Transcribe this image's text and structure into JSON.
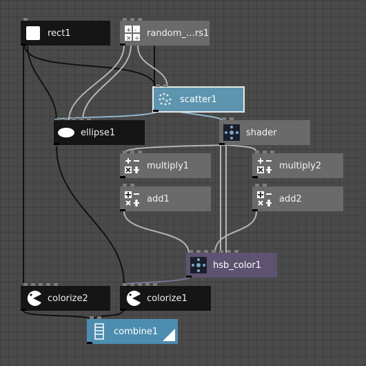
{
  "nodes": {
    "rect1": {
      "label": "rect1",
      "icon": "white-square-icon"
    },
    "random": {
      "label": "random_…rs1",
      "icon": "math-grid-icon"
    },
    "scatter1": {
      "label": "scatter1",
      "icon": "scatter-dots-icon"
    },
    "ellipse1": {
      "label": "ellipse1",
      "icon": "ellipse-icon"
    },
    "shader": {
      "label": "shader",
      "icon": "shader-crosshair-icon"
    },
    "multiply1": {
      "label": "multiply1",
      "icon": "math-operators-icon"
    },
    "multiply2": {
      "label": "multiply2",
      "icon": "math-operators-icon"
    },
    "add1": {
      "label": "add1",
      "icon": "math-operators-icon"
    },
    "add2": {
      "label": "add2",
      "icon": "math-operators-icon"
    },
    "hsb_color1": {
      "label": "hsb_color1",
      "icon": "shader-crosshair-icon"
    },
    "colorize2": {
      "label": "colorize2",
      "icon": "colorize-pacman-icon"
    },
    "colorize1": {
      "label": "colorize1",
      "icon": "colorize-pacman-icon"
    },
    "combine1": {
      "label": "combine1",
      "icon": "combine-stack-icon"
    }
  },
  "colors": {
    "canvas_bg": "#4a4a4a",
    "wire_dark": "#111111",
    "wire_light": "#b5b5b5",
    "wire_blue": "#8fb5cc",
    "wire_purple": "#7a6f94",
    "node_dark": "#151515",
    "node_gray": "#6a6a6a",
    "node_blue": "#4d8daf",
    "node_purple": "#5d5370"
  }
}
